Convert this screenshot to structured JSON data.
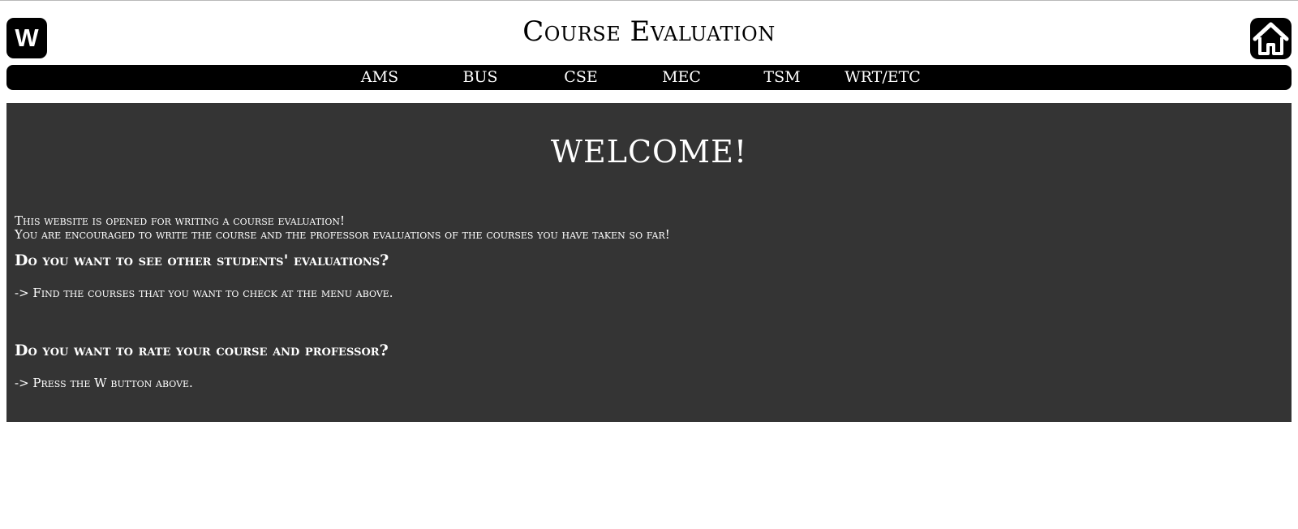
{
  "header": {
    "w_button_label": "W",
    "title": "Course Evaluation",
    "home_icon": "home-icon"
  },
  "nav": {
    "items": [
      "AMS",
      "BUS",
      "CSE",
      "MEC",
      "TSM",
      "WRT/ETC"
    ]
  },
  "main": {
    "welcome": "WELCOME!",
    "intro_line1": "This website is opened for writing a course evaluation!",
    "intro_line2": "You are encouraged to write the course and the professor evaluations of the courses you have taken so far!",
    "question1": "Do you want to see other students' evaluations?",
    "answer1": "-> Find the courses that you want to check at the menu above.",
    "question2": "Do you want to rate your course and professor?",
    "answer2": "-> Press the W button above."
  },
  "colors": {
    "bar": "#000000",
    "panel": "#343434",
    "text_light": "#ffffff"
  }
}
